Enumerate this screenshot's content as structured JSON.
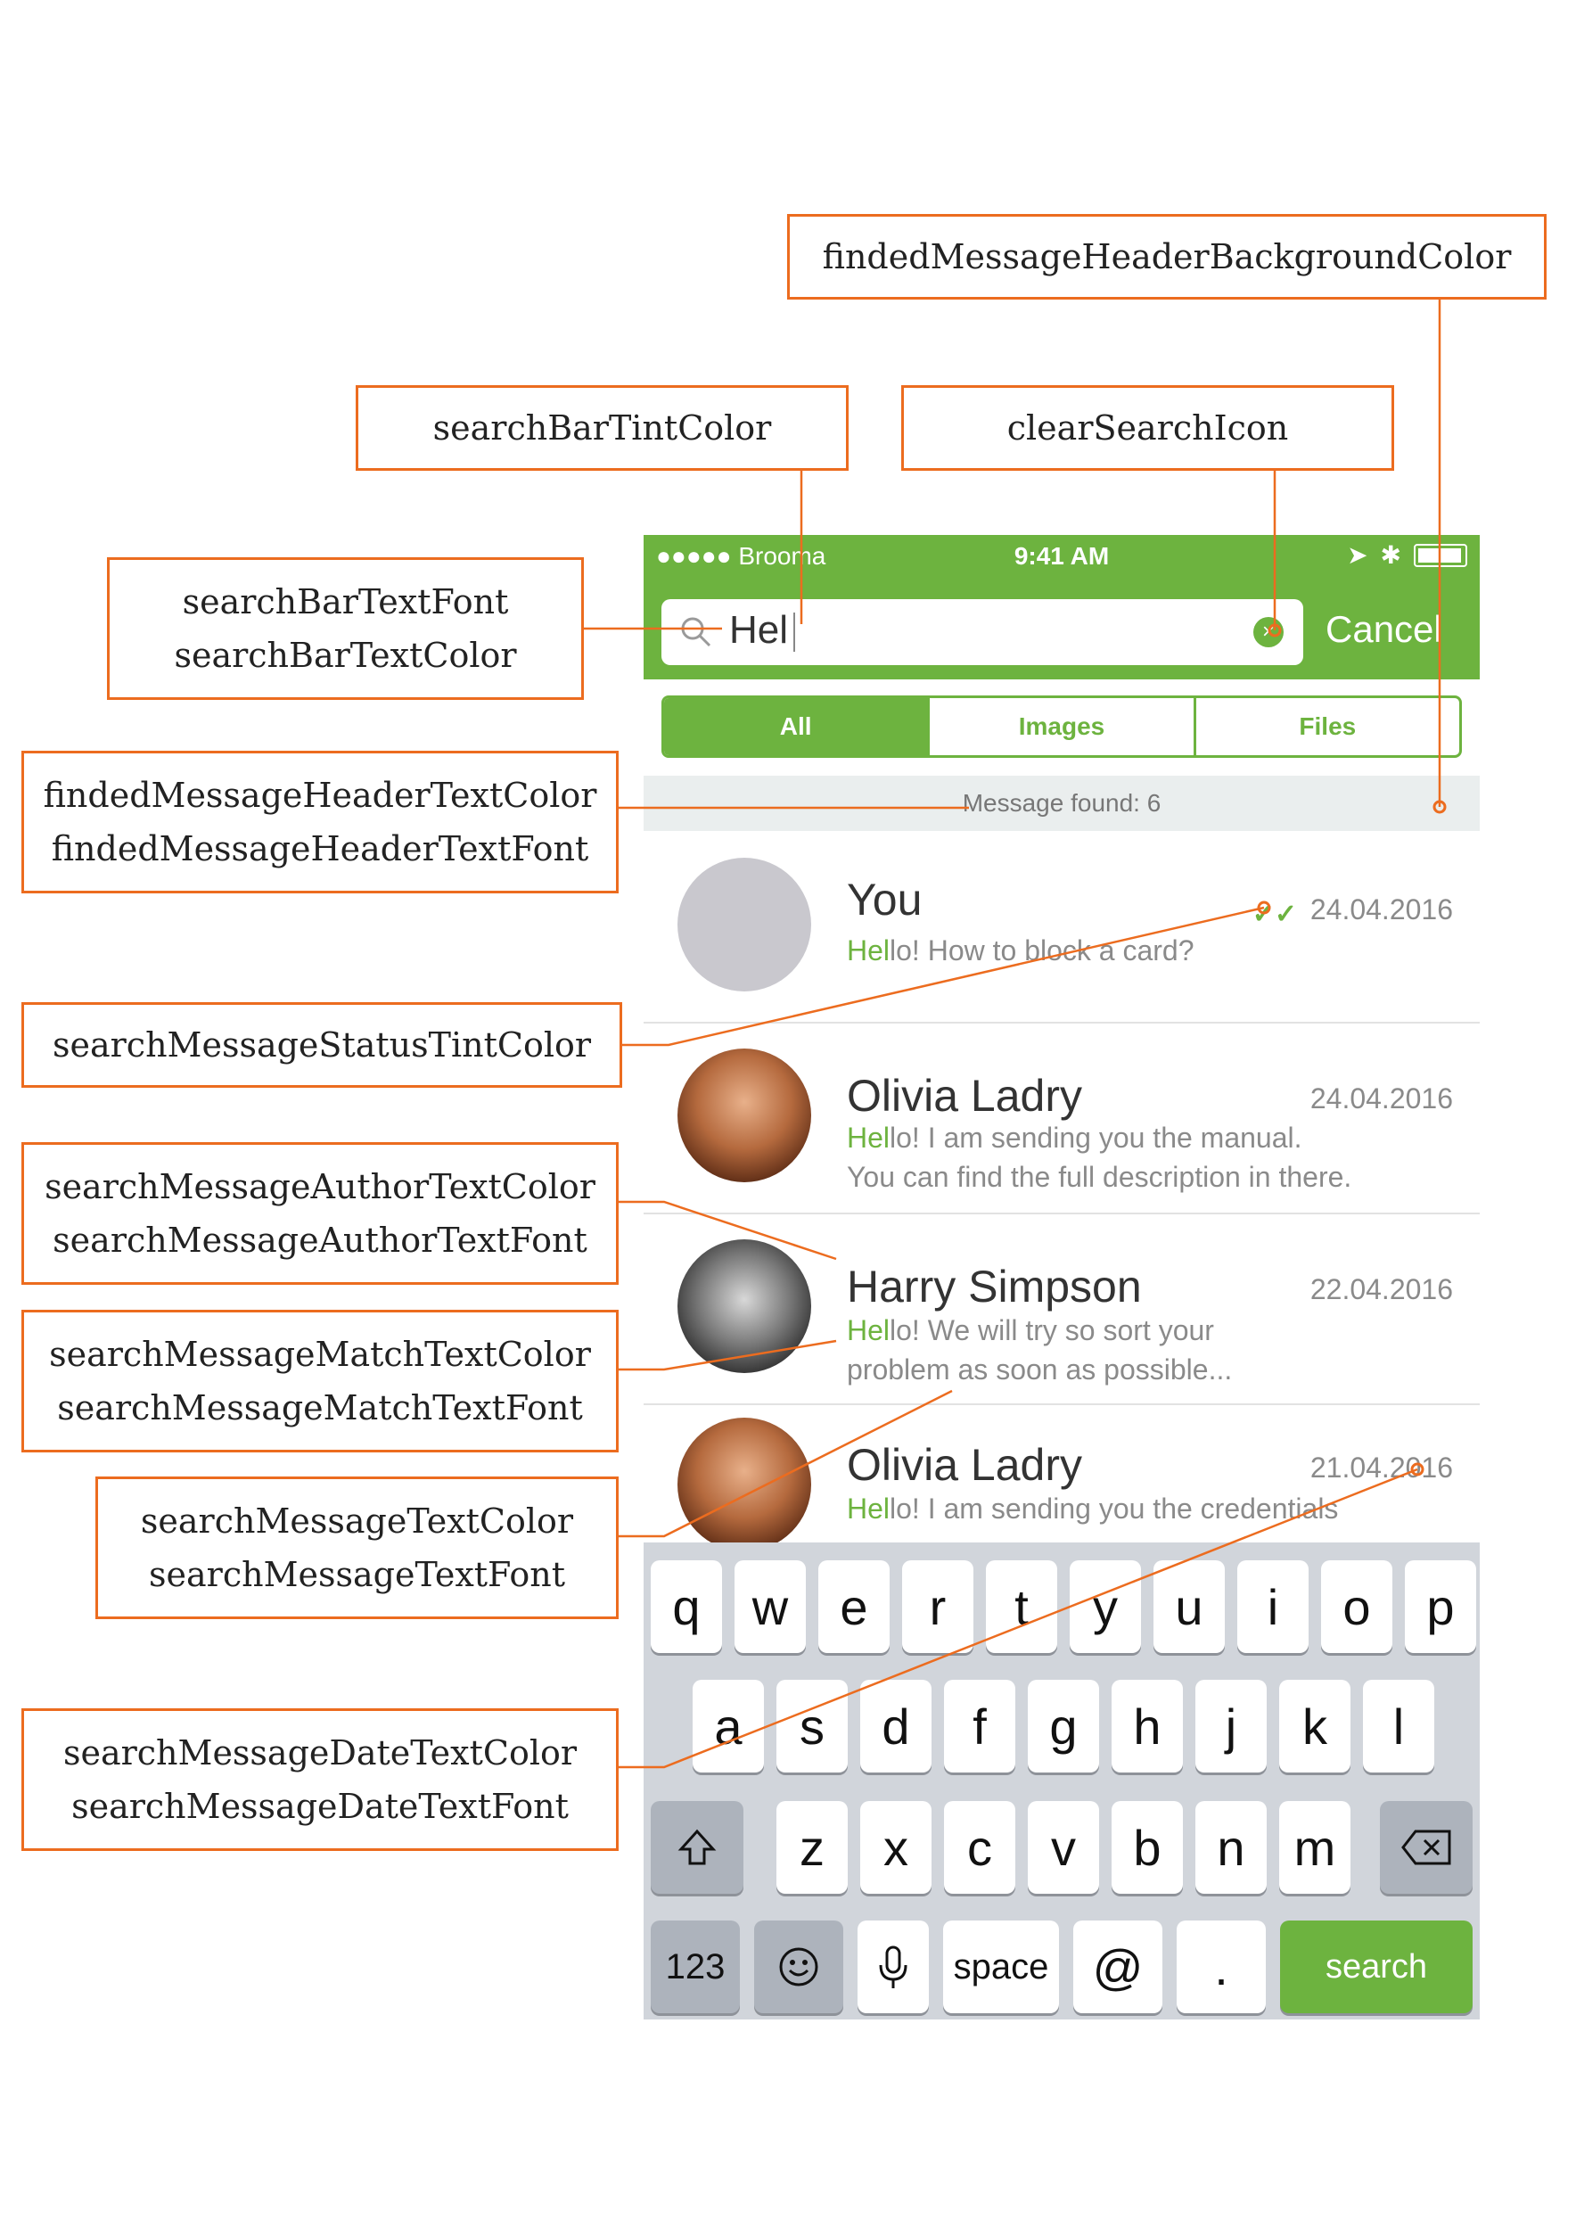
{
  "annotations": {
    "header_bg_color": "findedMessageHeaderBackgroundColor",
    "search_bar_tint": "searchBarTintColor",
    "clear_search_icon": "clearSearchIcon",
    "search_bar_text_font": "searchBarTextFont",
    "search_bar_text_color": "searchBarTextColor",
    "header_text_color": "findedMessageHeaderTextColor",
    "header_text_font": "findedMessageHeaderTextFont",
    "status_tint": "searchMessageStatusTintColor",
    "author_text_color": "searchMessageAuthorTextColor",
    "author_text_font": "searchMessageAuthorTextFont",
    "match_text_color": "searchMessageMatchTextColor",
    "match_text_font": "searchMessageMatchTextFont",
    "message_text_color": "searchMessageTextColor",
    "message_text_font": "searchMessageTextFont",
    "date_text_color": "searchMessageDateTextColor",
    "date_text_font": "searchMessageDateTextFont"
  },
  "status_bar": {
    "carrier": "●●●●● Brooma",
    "time": "9:41 AM"
  },
  "search": {
    "query": "Hel",
    "cancel_label": "Cancel"
  },
  "tabs": [
    "All",
    "Images",
    "Files"
  ],
  "found_label": "Message found: 6",
  "messages": [
    {
      "author": "You",
      "date": "24.04.2016",
      "match": "Hel",
      "text_line1": "lo! How to block a card?",
      "text_line2": ""
    },
    {
      "author": "Olivia Ladry",
      "date": "24.04.2016",
      "match": "Hel",
      "text_line1": "lo! I am sending you the manual.",
      "text_line2": "You can find the full description in there."
    },
    {
      "author": "Harry Simpson",
      "date": "22.04.2016",
      "match": "Hel",
      "text_line1": "lo! We will try so sort your",
      "text_line2": "problem as soon as possible..."
    },
    {
      "author": "Olivia Ladry",
      "date": "21.04.2016",
      "match": "Hel",
      "text_line1": "lo! I am sending you the credentials",
      "text_line2": ""
    }
  ],
  "keyboard": {
    "row1": [
      "q",
      "w",
      "e",
      "r",
      "t",
      "y",
      "u",
      "i",
      "o",
      "p"
    ],
    "row2": [
      "a",
      "s",
      "d",
      "f",
      "g",
      "h",
      "j",
      "k",
      "l"
    ],
    "row3": [
      "z",
      "x",
      "c",
      "v",
      "b",
      "n",
      "m"
    ],
    "numbers_label": "123",
    "space_label": "space",
    "at_label": "@",
    "dot_label": ".",
    "search_label": "search"
  },
  "colors": {
    "accent": "#6db33f",
    "annotation": "#ec6c1f"
  }
}
